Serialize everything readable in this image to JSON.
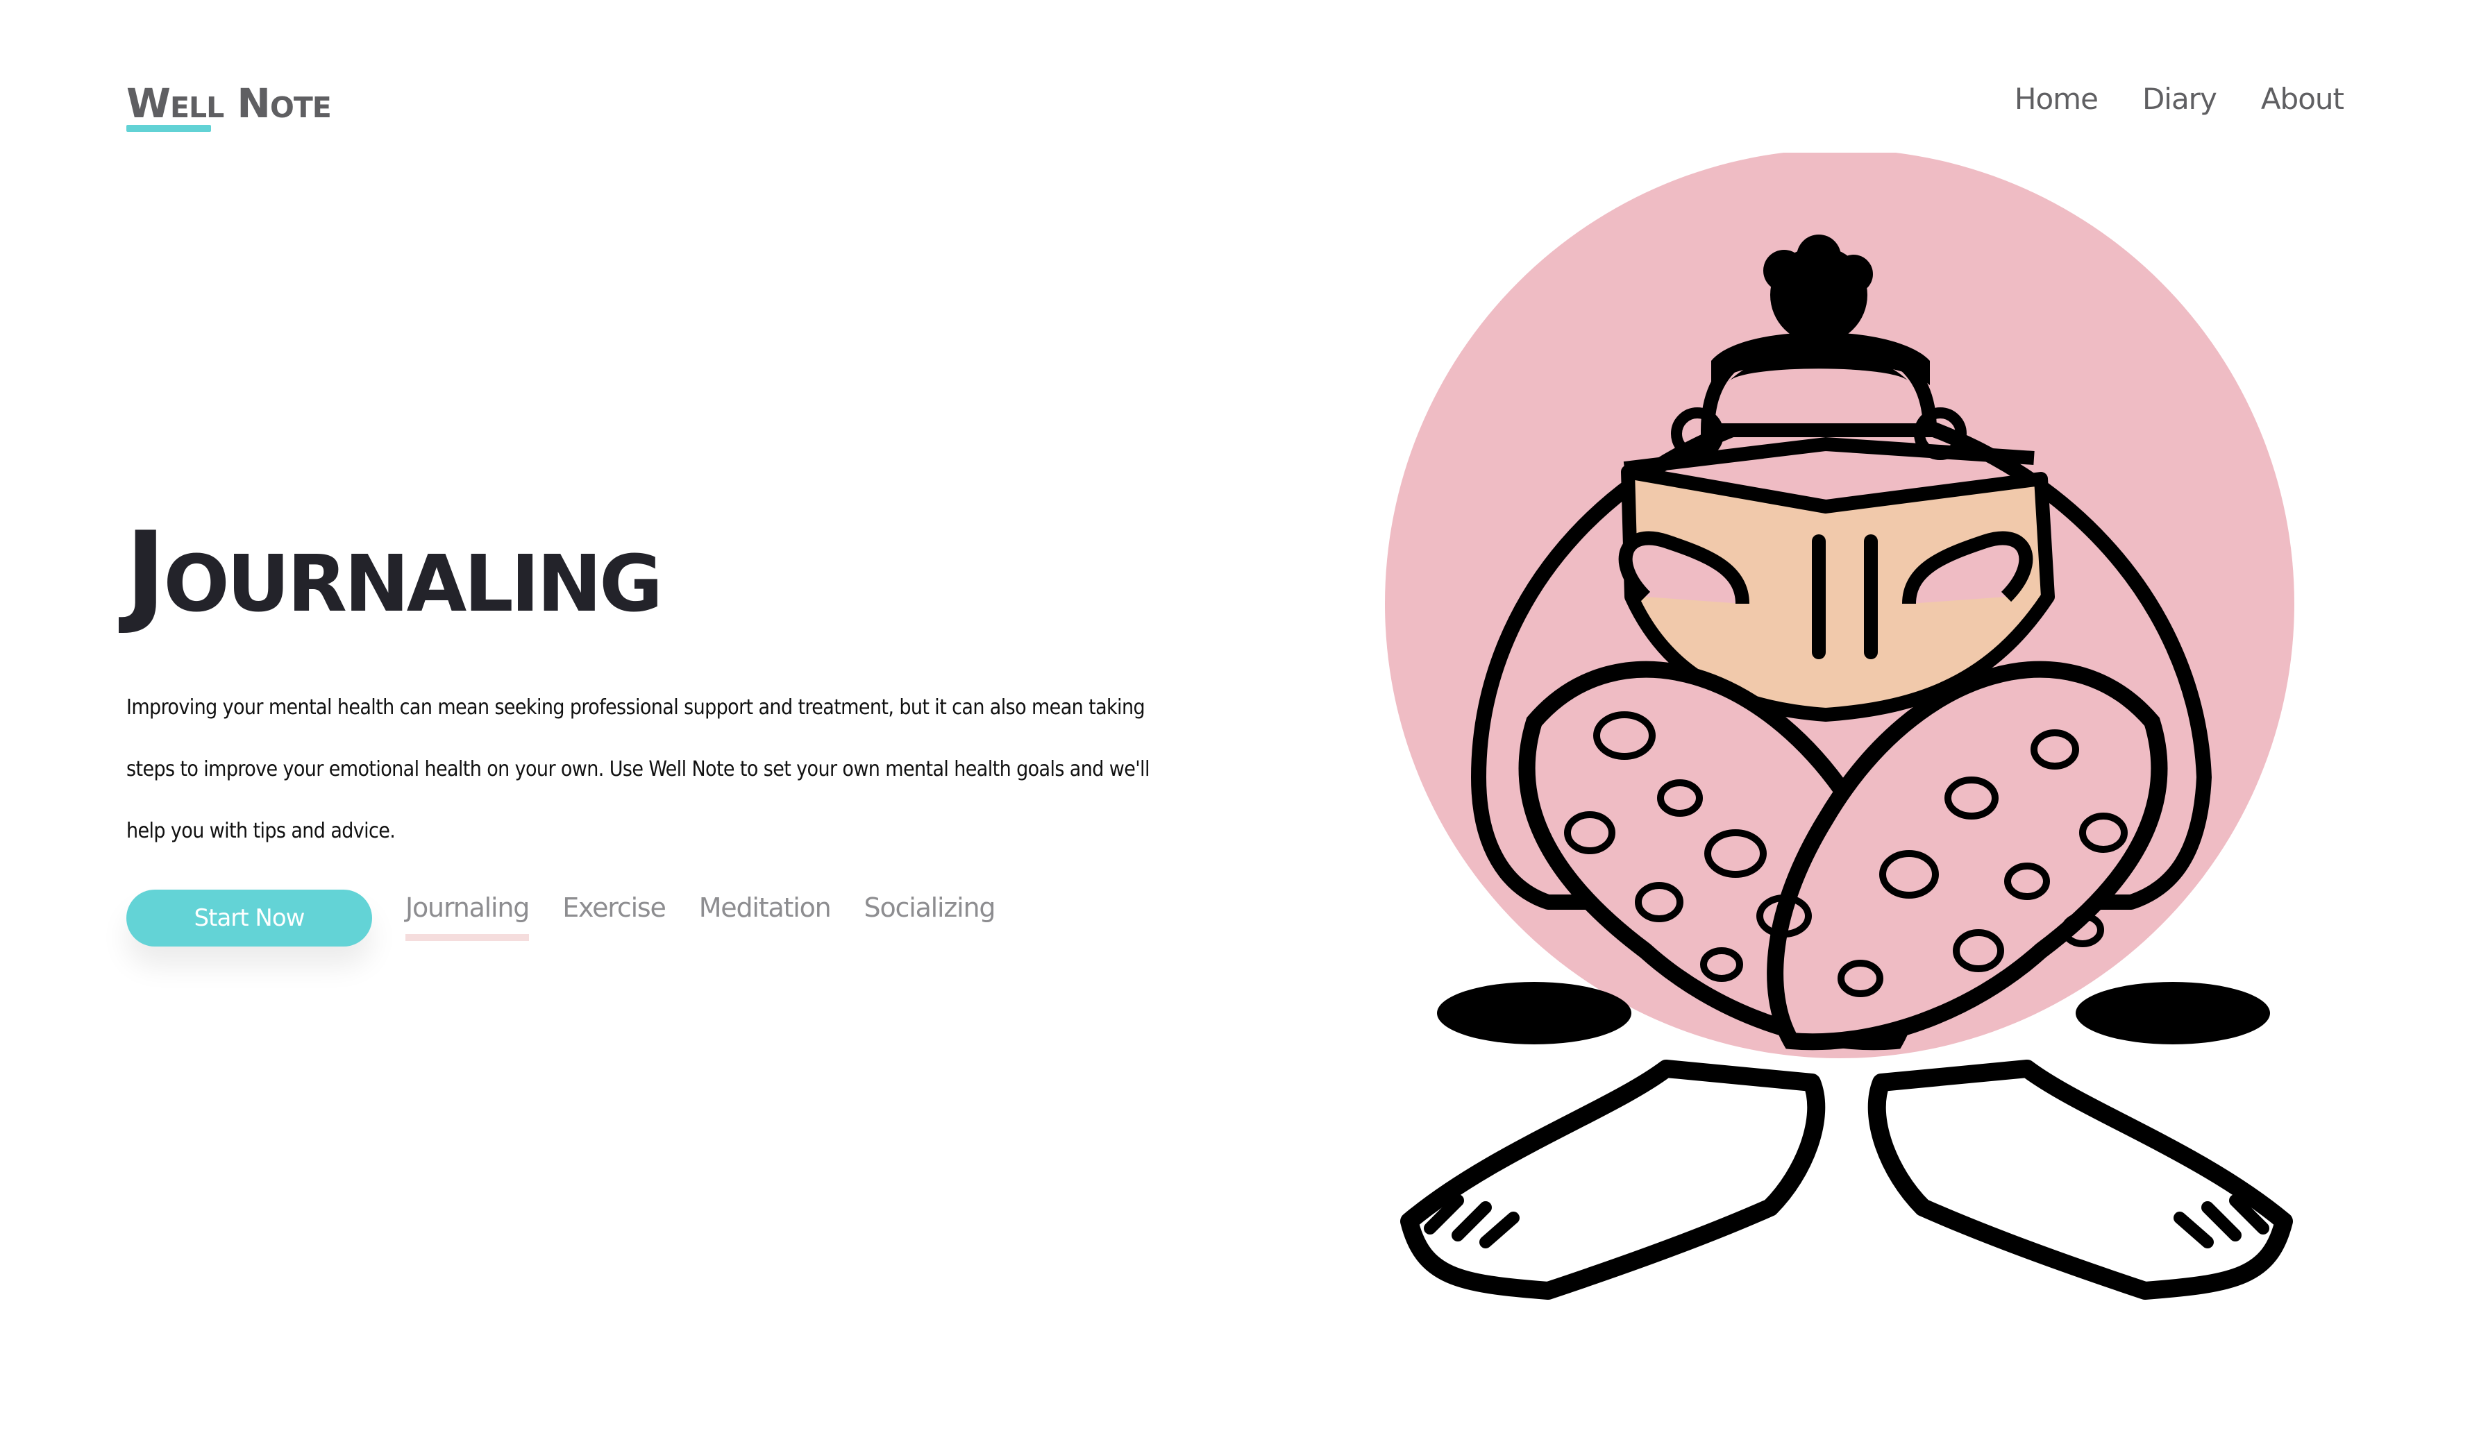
{
  "header": {
    "logo": "Well Note",
    "nav": [
      "Home",
      "Diary",
      "About"
    ]
  },
  "hero": {
    "title": "Journaling",
    "description": "Improving your mental health can mean seeking professional support and treatment, but it can also mean taking steps to improve your emotional health on your own. Use Well Note to set your own mental health goals and we'll help you with tips and advice.",
    "cta": "Start Now",
    "tabs": [
      "Journaling",
      "Exercise",
      "Meditation",
      "Socializing"
    ],
    "active_tab": "Journaling"
  },
  "colors": {
    "accent": "#63d3d6",
    "circle": "#efbcc4",
    "book": "#f1c9ab",
    "text_dark": "#23232a",
    "nav_text": "#5f5f62"
  },
  "illustration": {
    "icon": "person-reading-book-illustration"
  }
}
